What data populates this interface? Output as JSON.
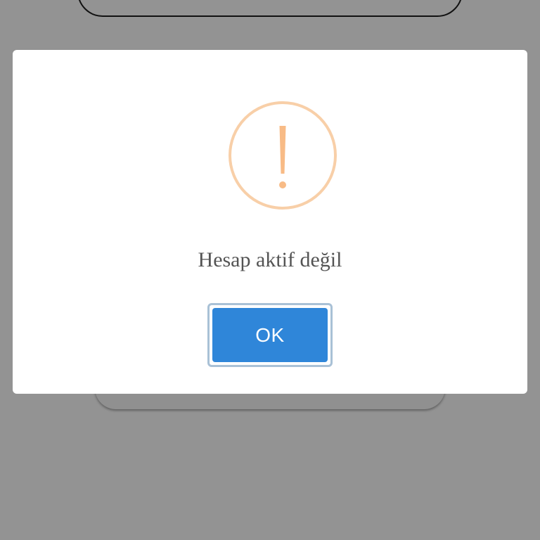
{
  "dialog": {
    "message": "Hesap aktif değil",
    "ok_label": "OK",
    "icon": "warning-exclamation-icon"
  },
  "colors": {
    "overlay": "#939393",
    "dialog_background": "#ffffff",
    "warning_accent": "#f8bb86",
    "button_background": "#2f86d9",
    "button_focus_ring": "#a9c1d6",
    "message_text": "#545454"
  }
}
